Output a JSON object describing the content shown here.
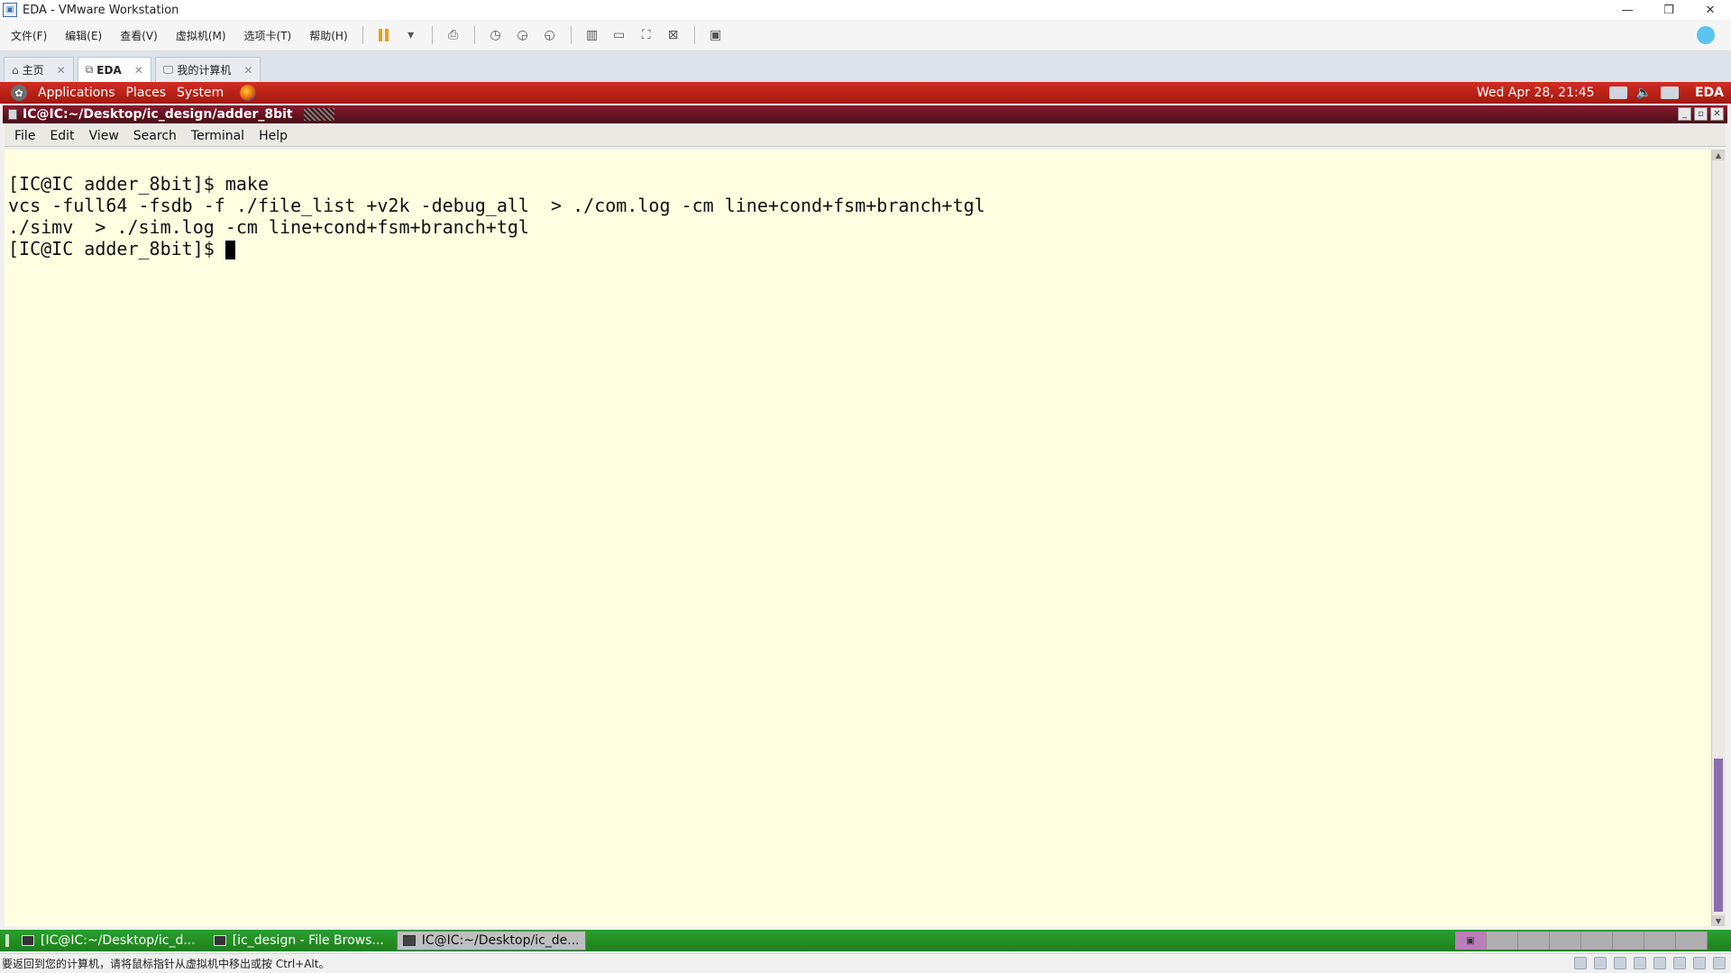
{
  "vmware": {
    "title": "EDA - VMware Workstation",
    "menus": [
      "文件(F)",
      "编辑(E)",
      "查看(V)",
      "虚拟机(M)",
      "选项卡(T)",
      "帮助(H)"
    ],
    "tabs": [
      {
        "label": "主页",
        "icon": "home-icon"
      },
      {
        "label": "EDA",
        "icon": "vm-icon"
      },
      {
        "label": "我的计算机",
        "icon": "computer-icon"
      }
    ],
    "status_message": "要返回到您的计算机，请将鼠标指针从虚拟机中移出或按 Ctrl+Alt。"
  },
  "guest_panel": {
    "menus": [
      "Applications",
      "Places",
      "System"
    ],
    "clock": "Wed Apr 28, 21:45",
    "hostname": "EDA"
  },
  "terminal": {
    "title": "IC@IC:~/Desktop/ic_design/adder_8bit",
    "menus": [
      "File",
      "Edit",
      "View",
      "Search",
      "Terminal",
      "Help"
    ],
    "lines": [
      "[IC@IC adder_8bit]$ make",
      "vcs -full64 -fsdb -f ./file_list +v2k -debug_all  > ./com.log -cm line+cond+fsm+branch+tgl",
      "./simv  > ./sim.log -cm line+cond+fsm+branch+tgl",
      "[IC@IC adder_8bit]$ "
    ]
  },
  "taskbar": {
    "items": [
      {
        "label": "[IC@IC:~/Desktop/ic_d...",
        "active": false
      },
      {
        "label": "[ic_design - File Brows...",
        "active": false
      },
      {
        "label": "IC@IC:~/Desktop/ic_de...",
        "active": true
      }
    ]
  },
  "colors": {
    "gnome_panel_red": "#c0261a",
    "terminal_bg": "#fefee0",
    "taskbar_green": "#23921f",
    "term_titlebar": "#6a1424"
  }
}
